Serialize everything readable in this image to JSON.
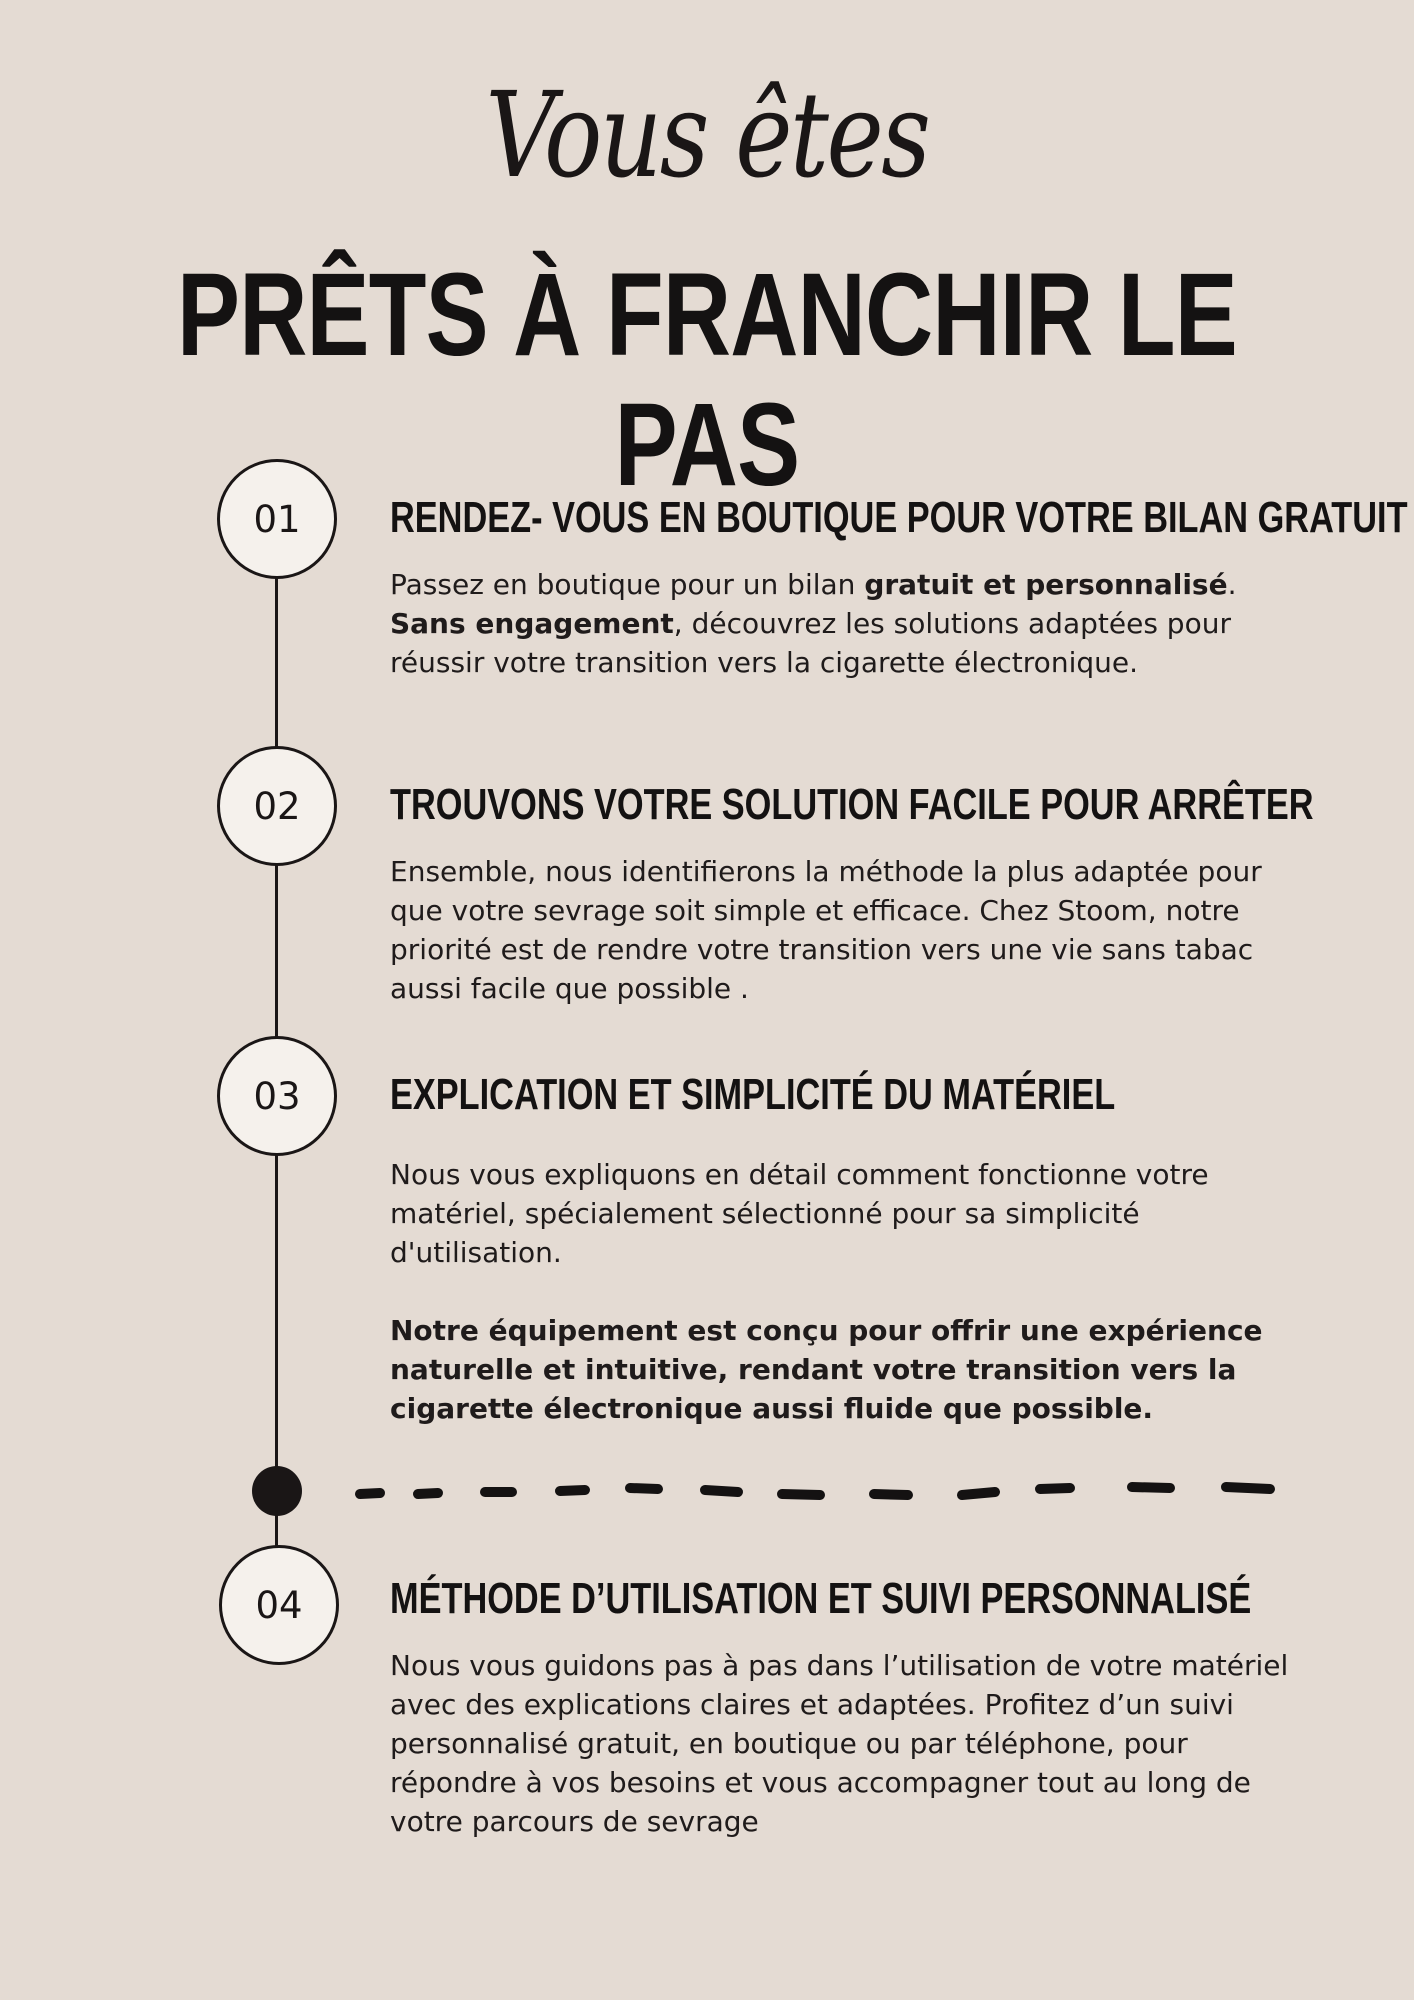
{
  "header": {
    "script_title": "Vous êtes",
    "main_title": "PRÊTS À FRANCHIR LE PAS"
  },
  "steps": [
    {
      "number": "01",
      "title": "RENDEZ- VOUS EN BOUTIQUE POUR VOTRE BILAN GRATUIT",
      "text_a": "Passez en boutique pour un bilan ",
      "text_b": "gratuit et personnalisé",
      "text_c": ".",
      "text_d": "Sans engagement",
      "text_e": ", découvrez les solutions adaptées pour réussir votre transition vers la cigarette électronique."
    },
    {
      "number": "02",
      "title": "TROUVONS VOTRE SOLUTION FACILE POUR ARRÊTER",
      "text": "Ensemble, nous identifierons la méthode la plus adaptée pour que votre sevrage soit simple et efficace. Chez Stoom, notre priorité est de rendre votre transition vers une vie sans tabac aussi facile que possible ."
    },
    {
      "number": "03",
      "title": "EXPLICATION ET SIMPLICITÉ DU MATÉRIEL",
      "text": "Nous vous expliquons en détail comment fonctionne votre matériel, spécialement sélectionné pour sa simplicité d'utilisation.",
      "bold_text": "Notre équipement est conçu pour offrir une expérience naturelle et intuitive, rendant votre transition vers la cigarette électronique aussi fluide que possible."
    },
    {
      "number": "04",
      "title": "MÉTHODE D’UTILISATION ET SUIVI PERSONNALISÉ",
      "text": "Nous vous guidons pas à pas dans l’utilisation de votre matériel avec des explications claires et adaptées. Profitez d’un suivi personnalisé gratuit, en boutique ou par téléphone, pour répondre à vos besoins et vous accompagner tout au long de votre parcours de sevrage"
    }
  ],
  "colors": {
    "background": "#e4dbd3",
    "ink": "#1a1616",
    "circle_fill": "#f5f1ec"
  }
}
